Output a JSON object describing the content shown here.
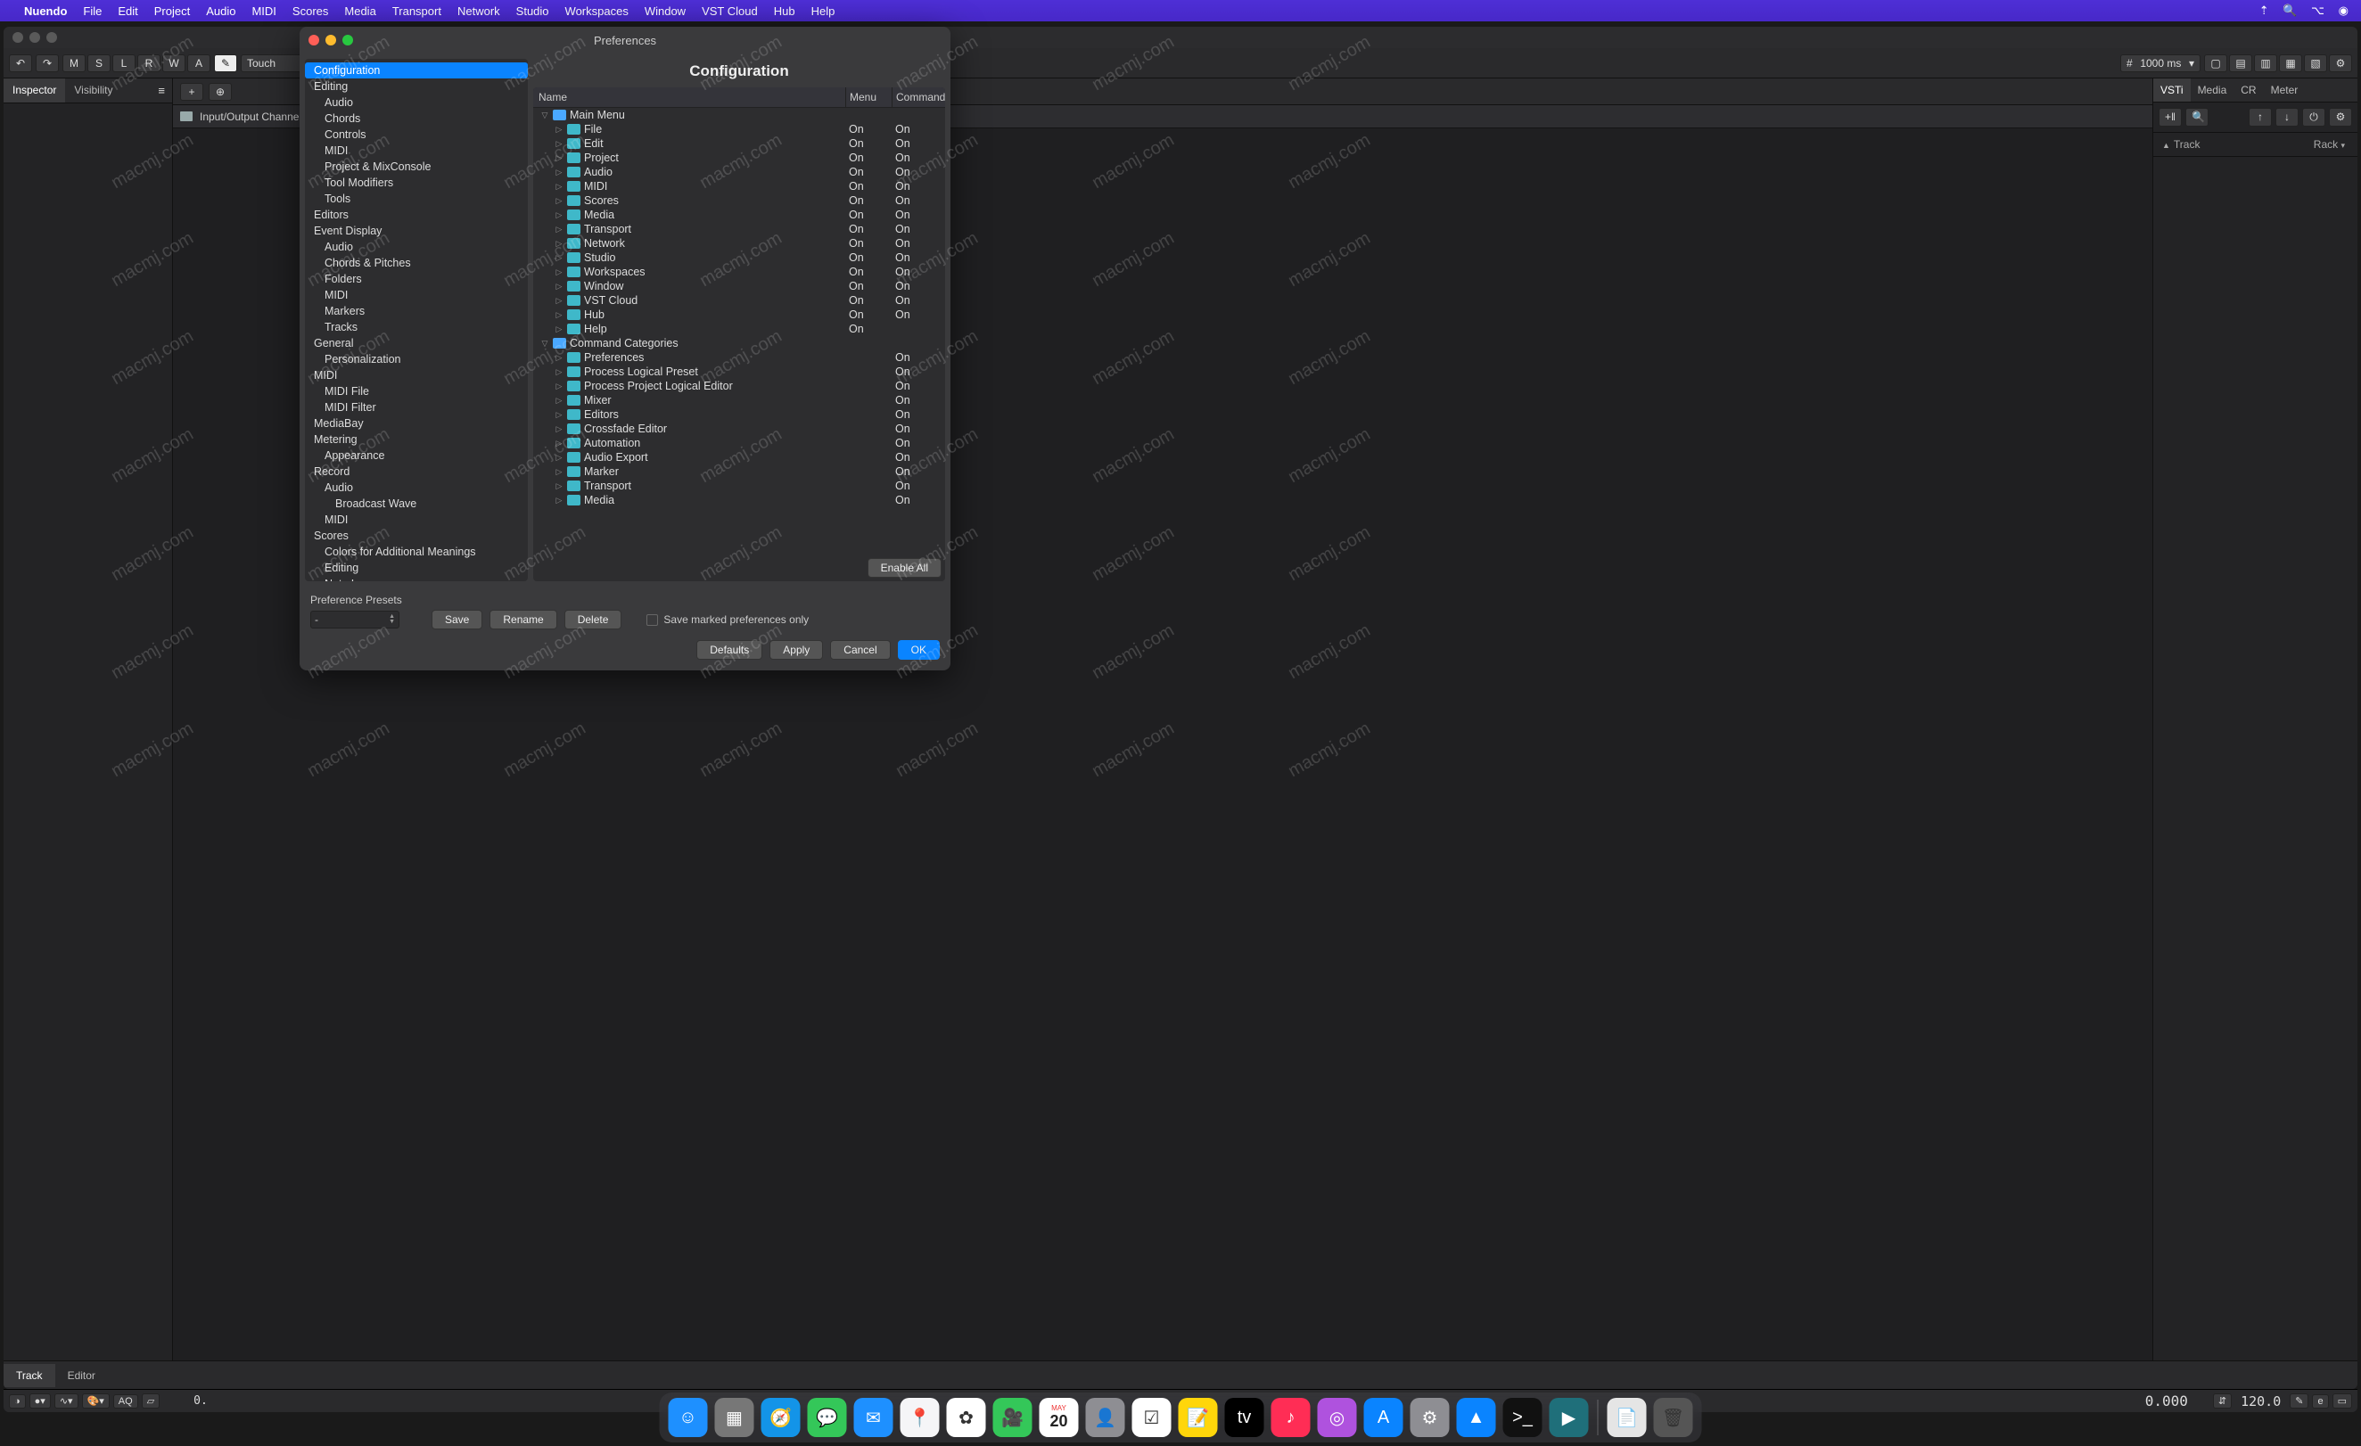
{
  "menubar": {
    "app": "Nuendo",
    "items": [
      "File",
      "Edit",
      "Project",
      "Audio",
      "MIDI",
      "Scores",
      "Media",
      "Transport",
      "Network",
      "Studio",
      "Workspaces",
      "Window",
      "VST Cloud",
      "Hub",
      "Help"
    ]
  },
  "toolbar": {
    "letters": [
      "M",
      "S",
      "L",
      "R",
      "W",
      "A"
    ],
    "automation_mode": "Touch",
    "grid_value": "1000 ms"
  },
  "left_tabs": {
    "inspector": "Inspector",
    "visibility": "Visibility"
  },
  "track_list": {
    "input_output": "Input/Output Channels"
  },
  "bottom_tabs": {
    "track": "Track",
    "editor": "Editor"
  },
  "right_panel": {
    "tabs": [
      "VSTi",
      "Media",
      "CR",
      "Meter"
    ],
    "col_track": "Track",
    "col_rack": "Rack"
  },
  "status": {
    "aq": "AQ",
    "pos": "0.",
    "tempo_big": "0.000",
    "tempo": "120.0"
  },
  "dialog": {
    "title": "Preferences",
    "right_title": "Configuration",
    "columns": {
      "name": "Name",
      "menu": "Menu",
      "comm": "Command"
    },
    "tree": [
      {
        "label": "Configuration",
        "depth": 0,
        "selected": true
      },
      {
        "label": "Editing",
        "depth": 0
      },
      {
        "label": "Audio",
        "depth": 1
      },
      {
        "label": "Chords",
        "depth": 1
      },
      {
        "label": "Controls",
        "depth": 1
      },
      {
        "label": "MIDI",
        "depth": 1
      },
      {
        "label": "Project & MixConsole",
        "depth": 1
      },
      {
        "label": "Tool Modifiers",
        "depth": 1
      },
      {
        "label": "Tools",
        "depth": 1
      },
      {
        "label": "Editors",
        "depth": 0
      },
      {
        "label": "Event Display",
        "depth": 0
      },
      {
        "label": "Audio",
        "depth": 1
      },
      {
        "label": "Chords & Pitches",
        "depth": 1
      },
      {
        "label": "Folders",
        "depth": 1
      },
      {
        "label": "MIDI",
        "depth": 1
      },
      {
        "label": "Markers",
        "depth": 1
      },
      {
        "label": "Tracks",
        "depth": 1
      },
      {
        "label": "General",
        "depth": 0
      },
      {
        "label": "Personalization",
        "depth": 1
      },
      {
        "label": "MIDI",
        "depth": 0
      },
      {
        "label": "MIDI File",
        "depth": 1
      },
      {
        "label": "MIDI Filter",
        "depth": 1
      },
      {
        "label": "MediaBay",
        "depth": 0
      },
      {
        "label": "Metering",
        "depth": 0
      },
      {
        "label": "Appearance",
        "depth": 1
      },
      {
        "label": "Record",
        "depth": 0
      },
      {
        "label": "Audio",
        "depth": 1
      },
      {
        "label": "Broadcast Wave",
        "depth": 2
      },
      {
        "label": "MIDI",
        "depth": 1
      },
      {
        "label": "Scores",
        "depth": 0
      },
      {
        "label": "Colors for Additional Meanings",
        "depth": 1
      },
      {
        "label": "Editing",
        "depth": 1
      },
      {
        "label": "Note Layer",
        "depth": 1
      }
    ],
    "rows": [
      {
        "label": "Main Menu",
        "depth": 0,
        "open": true,
        "menu": "",
        "comm": "",
        "color": "blue"
      },
      {
        "label": "File",
        "depth": 1,
        "menu": "On",
        "comm": "On",
        "color": "teal"
      },
      {
        "label": "Edit",
        "depth": 1,
        "menu": "On",
        "comm": "On",
        "color": "teal"
      },
      {
        "label": "Project",
        "depth": 1,
        "menu": "On",
        "comm": "On",
        "color": "teal"
      },
      {
        "label": "Audio",
        "depth": 1,
        "menu": "On",
        "comm": "On",
        "color": "teal"
      },
      {
        "label": "MIDI",
        "depth": 1,
        "menu": "On",
        "comm": "On",
        "color": "teal"
      },
      {
        "label": "Scores",
        "depth": 1,
        "menu": "On",
        "comm": "On",
        "color": "teal"
      },
      {
        "label": "Media",
        "depth": 1,
        "menu": "On",
        "comm": "On",
        "color": "teal"
      },
      {
        "label": "Transport",
        "depth": 1,
        "menu": "On",
        "comm": "On",
        "color": "teal"
      },
      {
        "label": "Network",
        "depth": 1,
        "menu": "On",
        "comm": "On",
        "color": "teal"
      },
      {
        "label": "Studio",
        "depth": 1,
        "menu": "On",
        "comm": "On",
        "color": "teal"
      },
      {
        "label": "Workspaces",
        "depth": 1,
        "menu": "On",
        "comm": "On",
        "color": "teal"
      },
      {
        "label": "Window",
        "depth": 1,
        "menu": "On",
        "comm": "On",
        "color": "teal"
      },
      {
        "label": "VST Cloud",
        "depth": 1,
        "menu": "On",
        "comm": "On",
        "color": "teal"
      },
      {
        "label": "Hub",
        "depth": 1,
        "menu": "On",
        "comm": "On",
        "color": "teal"
      },
      {
        "label": "Help",
        "depth": 1,
        "menu": "On",
        "comm": "",
        "color": "teal"
      },
      {
        "label": "Command Categories",
        "depth": 0,
        "open": true,
        "menu": "",
        "comm": "",
        "color": "blue"
      },
      {
        "label": "Preferences",
        "depth": 1,
        "menu": "",
        "comm": "On",
        "color": "teal"
      },
      {
        "label": "Process Logical Preset",
        "depth": 1,
        "menu": "",
        "comm": "On",
        "color": "teal"
      },
      {
        "label": "Process Project Logical Editor",
        "depth": 1,
        "menu": "",
        "comm": "On",
        "color": "teal"
      },
      {
        "label": "Mixer",
        "depth": 1,
        "menu": "",
        "comm": "On",
        "color": "teal"
      },
      {
        "label": "Editors",
        "depth": 1,
        "menu": "",
        "comm": "On",
        "color": "teal"
      },
      {
        "label": "Crossfade Editor",
        "depth": 1,
        "menu": "",
        "comm": "On",
        "color": "teal"
      },
      {
        "label": "Automation",
        "depth": 1,
        "menu": "",
        "comm": "On",
        "color": "teal"
      },
      {
        "label": "Audio Export",
        "depth": 1,
        "menu": "",
        "comm": "On",
        "color": "teal"
      },
      {
        "label": "Marker",
        "depth": 1,
        "menu": "",
        "comm": "On",
        "color": "teal"
      },
      {
        "label": "Transport",
        "depth": 1,
        "menu": "",
        "comm": "On",
        "color": "teal"
      },
      {
        "label": "Media",
        "depth": 1,
        "menu": "",
        "comm": "On",
        "color": "teal"
      }
    ],
    "enable_all": "Enable All",
    "presets_label": "Preference Presets",
    "preset_value": "-",
    "save": "Save",
    "rename": "Rename",
    "delete": "Delete",
    "save_marked": "Save marked preferences only",
    "defaults": "Defaults",
    "apply": "Apply",
    "cancel": "Cancel",
    "ok": "OK"
  },
  "dock": {
    "apps": [
      {
        "name": "finder",
        "bg": "#1e90ff",
        "glyph": "☺"
      },
      {
        "name": "launchpad",
        "bg": "#777",
        "glyph": "▦"
      },
      {
        "name": "safari",
        "bg": "#1394e8",
        "glyph": "🧭"
      },
      {
        "name": "messages",
        "bg": "#34c759",
        "glyph": "💬"
      },
      {
        "name": "mail",
        "bg": "#1e90ff",
        "glyph": "✉"
      },
      {
        "name": "maps",
        "bg": "#f5f5f7",
        "glyph": "📍"
      },
      {
        "name": "photos",
        "bg": "#fff",
        "glyph": "✿"
      },
      {
        "name": "facetime",
        "bg": "#34c759",
        "glyph": "🎥"
      },
      {
        "name": "calendar",
        "bg": "#fff",
        "glyph": "20"
      },
      {
        "name": "contacts",
        "bg": "#8e8e93",
        "glyph": "👤"
      },
      {
        "name": "reminders",
        "bg": "#fff",
        "glyph": "☑"
      },
      {
        "name": "notes",
        "bg": "#ffd60a",
        "glyph": "📝"
      },
      {
        "name": "tv",
        "bg": "#000",
        "glyph": "tv"
      },
      {
        "name": "music",
        "bg": "#ff2d55",
        "glyph": "♪"
      },
      {
        "name": "podcasts",
        "bg": "#af52de",
        "glyph": "◎"
      },
      {
        "name": "appstore",
        "bg": "#0a84ff",
        "glyph": "A"
      },
      {
        "name": "settings",
        "bg": "#8e8e93",
        "glyph": "⚙"
      },
      {
        "name": "app1",
        "bg": "#0a84ff",
        "glyph": "▲"
      },
      {
        "name": "terminal",
        "bg": "#111",
        "glyph": ">_"
      },
      {
        "name": "nuendo",
        "bg": "#1f6f7a",
        "glyph": "▶"
      }
    ],
    "extras": [
      {
        "name": "script",
        "bg": "#e5e5e5",
        "glyph": "📄"
      },
      {
        "name": "trash",
        "bg": "#555",
        "glyph": "🗑"
      }
    ],
    "cal_month": "MAY",
    "cal_day": "20"
  },
  "watermark": "macmj.com"
}
